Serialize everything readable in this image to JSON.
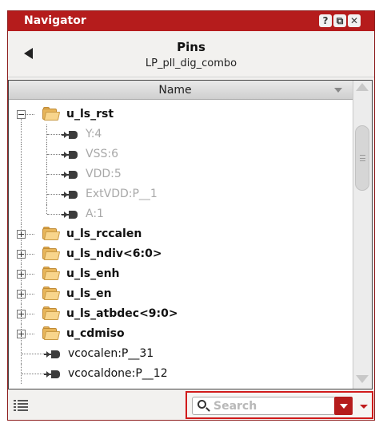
{
  "window": {
    "title": "Navigator",
    "buttons": {
      "help": "?",
      "float": "⧉",
      "close": "✕"
    }
  },
  "header": {
    "title": "Pins",
    "subtitle": "LP_pll_dig_combo"
  },
  "tree": {
    "column_header": "Name",
    "rows": [
      {
        "type": "group",
        "label": "u_ls_rst",
        "expanded": true,
        "depth": 0
      },
      {
        "type": "pin",
        "label": "Y:4",
        "dim": true,
        "depth": 1
      },
      {
        "type": "pin",
        "label": "VSS:6",
        "dim": true,
        "depth": 1
      },
      {
        "type": "pin",
        "label": "VDD:5",
        "dim": true,
        "depth": 1
      },
      {
        "type": "pin",
        "label": "ExtVDD:P__1",
        "dim": true,
        "depth": 1
      },
      {
        "type": "pin",
        "label": "A:1",
        "dim": true,
        "depth": 1
      },
      {
        "type": "group",
        "label": "u_ls_rccalen",
        "expanded": false,
        "depth": 0
      },
      {
        "type": "group",
        "label": "u_ls_ndiv<6:0>",
        "expanded": false,
        "depth": 0
      },
      {
        "type": "group",
        "label": "u_ls_enh",
        "expanded": false,
        "depth": 0
      },
      {
        "type": "group",
        "label": "u_ls_en",
        "expanded": false,
        "depth": 0
      },
      {
        "type": "group",
        "label": "u_ls_atbdec<9:0>",
        "expanded": false,
        "depth": 0
      },
      {
        "type": "group",
        "label": "u_cdmiso",
        "expanded": false,
        "depth": 0
      },
      {
        "type": "pin",
        "label": "vcocalen:P__31",
        "dim": false,
        "depth": 0
      },
      {
        "type": "pin",
        "label": "vcocaldone:P__12",
        "dim": false,
        "depth": 0
      }
    ]
  },
  "bottom": {
    "search_placeholder": "Search"
  },
  "colors": {
    "title_bar": "#b51c1c",
    "search_highlight": "#d11b1b",
    "folder": "#e7b55a"
  }
}
